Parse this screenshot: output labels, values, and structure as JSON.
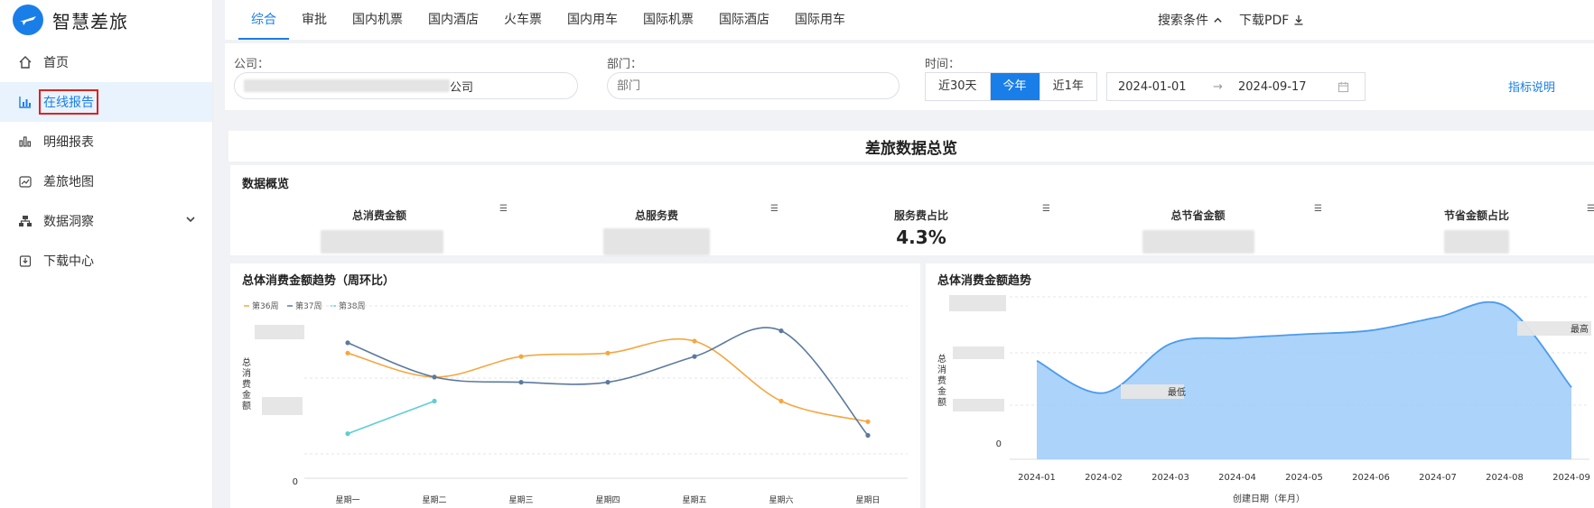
{
  "app": {
    "title": "智慧差旅"
  },
  "sidebar": {
    "items": [
      {
        "label": "首页",
        "icon": "home-icon"
      },
      {
        "label": "在线报告",
        "icon": "bar-chart-icon"
      },
      {
        "label": "明细报表",
        "icon": "columns-icon"
      },
      {
        "label": "差旅地图",
        "icon": "trend-icon"
      },
      {
        "label": "数据洞察",
        "icon": "org-icon"
      },
      {
        "label": "下载中心",
        "icon": "download-box-icon"
      }
    ]
  },
  "tabs": [
    "综合",
    "审批",
    "国内机票",
    "国内酒店",
    "火车票",
    "国内用车",
    "国际机票",
    "国际酒店",
    "国际用车"
  ],
  "toolbar": {
    "search_conditions": "搜索条件",
    "download_pdf": "下载PDF"
  },
  "filters": {
    "company_label": "公司：",
    "company_value_suffix": "公司",
    "department_label": "部门：",
    "department_placeholder": "部门",
    "time_label": "时间：",
    "ranges": [
      "近30天",
      "今年",
      "近1年"
    ],
    "start_date": "2024-01-01",
    "end_date": "2024-09-17",
    "separator": "→",
    "metric_help": "指标说明"
  },
  "overview": {
    "title": "差旅数据总览",
    "section_title": "数据概览",
    "kpis": [
      {
        "label": "总消费金额",
        "value": ""
      },
      {
        "label": "总服务费",
        "value": ""
      },
      {
        "label": "服务费占比",
        "value": "4.3%"
      },
      {
        "label": "总节省金额",
        "value": ""
      },
      {
        "label": "节省金额占比",
        "value": ""
      }
    ]
  },
  "colors": {
    "accent": "#1a7ee8",
    "week36": "#f5a742",
    "week37": "#5b7a9e",
    "week38": "#5fcdd4",
    "area": "#4b9af0"
  },
  "charts": {
    "weekly": {
      "title": "总体消费金额趋势（周环比）",
      "ylabel": "总消费金额",
      "zero_tick": "0"
    },
    "monthly": {
      "title": "总体消费金额趋势",
      "ylabel": "总消费金额",
      "xlabel": "创建日期（年月）",
      "zero_tick": "0",
      "low_label": "最低",
      "high_label": "最高"
    }
  },
  "chart_data": [
    {
      "type": "line",
      "title": "总体消费金额趋势（周环比）",
      "ylabel": "总消费金额",
      "categories": [
        "星期一",
        "星期二",
        "星期三",
        "星期四",
        "星期五",
        "星期六",
        "星期日"
      ],
      "series": [
        {
          "name": "第36周",
          "color": "#f5a742",
          "values": [
            0.73,
            0.59,
            0.71,
            0.73,
            0.8,
            0.45,
            0.33
          ]
        },
        {
          "name": "第37周",
          "color": "#5b7a9e",
          "values": [
            0.79,
            0.59,
            0.56,
            0.56,
            0.71,
            0.86,
            0.25
          ]
        },
        {
          "name": "第38周",
          "color": "#5fcdd4",
          "values": [
            0.26,
            0.45,
            null,
            null,
            null,
            null,
            null
          ]
        }
      ],
      "legend": "top-left",
      "grid": true
    },
    {
      "type": "area",
      "title": "总体消费金额趋势",
      "ylabel": "总消费金额",
      "xlabel": "创建日期（年月）",
      "categories": [
        "2024-01",
        "2024-02",
        "2024-03",
        "2024-04",
        "2024-05",
        "2024-06",
        "2024-07",
        "2024-08",
        "2024-09"
      ],
      "values": [
        0.52,
        0.35,
        0.61,
        0.64,
        0.66,
        0.68,
        0.75,
        0.81,
        0.38
      ],
      "color": "#4b9af0",
      "grid": true
    }
  ]
}
